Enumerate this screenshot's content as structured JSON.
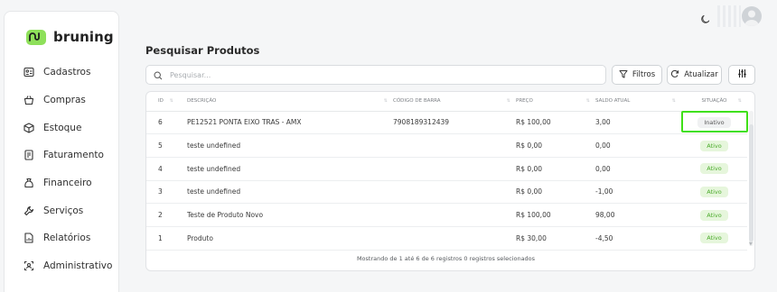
{
  "brand": {
    "name": "bruning",
    "accent": "#8ee05a"
  },
  "sidebar": {
    "items": [
      {
        "label": "Cadastros",
        "icon": "id-card-icon"
      },
      {
        "label": "Compras",
        "icon": "basket-icon"
      },
      {
        "label": "Estoque",
        "icon": "box-icon"
      },
      {
        "label": "Faturamento",
        "icon": "receipt-icon"
      },
      {
        "label": "Financeiro",
        "icon": "money-bag-icon"
      },
      {
        "label": "Serviços",
        "icon": "wrench-icon"
      },
      {
        "label": "Relatórios",
        "icon": "report-icon"
      },
      {
        "label": "Administrativo",
        "icon": "admin-icon"
      }
    ]
  },
  "main": {
    "title": "Pesquisar Produtos",
    "search": {
      "placeholder": "Pesquisar...",
      "value": ""
    },
    "toolbar": {
      "filters_label": "Filtros",
      "refresh_label": "Atualizar"
    },
    "table": {
      "columns": [
        "ID",
        "DESCRIÇÃO",
        "CÓDIGO DE BARRA",
        "PREÇO",
        "SALDO ATUAL",
        "SITUAÇÃO"
      ],
      "rows": [
        {
          "id": "6",
          "desc": "PE12521 PONTA EIXO TRAS - AMX",
          "cod": "7908189312439",
          "preco": "R$ 100,00",
          "saldo": "3,00",
          "situacao": "Inativo"
        },
        {
          "id": "5",
          "desc": "teste undefined",
          "cod": "",
          "preco": "R$ 0,00",
          "saldo": "0,00",
          "situacao": "Ativo"
        },
        {
          "id": "4",
          "desc": "teste undefined",
          "cod": "",
          "preco": "R$ 0,00",
          "saldo": "0,00",
          "situacao": "Ativo"
        },
        {
          "id": "3",
          "desc": "teste undefined",
          "cod": "",
          "preco": "R$ 0,00",
          "saldo": "-1,00",
          "situacao": "Ativo"
        },
        {
          "id": "2",
          "desc": "Teste de Produto Novo",
          "cod": "",
          "preco": "R$ 100,00",
          "saldo": "98,00",
          "situacao": "Ativo"
        },
        {
          "id": "1",
          "desc": "Produto",
          "cod": "",
          "preco": "R$ 30,00",
          "saldo": "-4,50",
          "situacao": "Ativo"
        }
      ]
    },
    "footer": "Mostrando de 1 até 6 de 6 registros   0 registros selecionados"
  },
  "colors": {
    "active_badge_bg": "#e6f6dc",
    "active_badge_text": "#4bab2b",
    "highlight": "#3fe017"
  }
}
